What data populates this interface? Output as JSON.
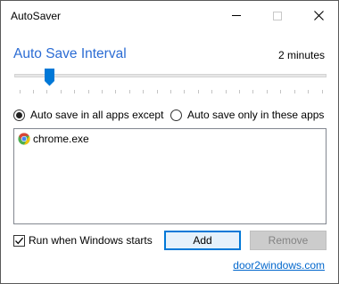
{
  "window": {
    "title": "AutoSaver"
  },
  "interval": {
    "title": "Auto Save Interval",
    "value_label": "2 minutes",
    "slider_fraction": 0.1,
    "tick_count": 23
  },
  "mode": {
    "options": [
      {
        "label": "Auto save in all apps except",
        "selected": true
      },
      {
        "label": "Auto save only in these apps",
        "selected": false
      }
    ]
  },
  "app_list": {
    "items": [
      {
        "label": "chrome.exe",
        "icon": "chrome-icon"
      }
    ]
  },
  "footer": {
    "run_on_start_label": "Run when Windows starts",
    "run_on_start_checked": true,
    "add_label": "Add",
    "remove_label": "Remove",
    "remove_enabled": false,
    "link_label": "door2windows.com"
  },
  "colors": {
    "accent": "#0078d7",
    "title_blue": "#2b6cd4",
    "link": "#0066cc"
  }
}
